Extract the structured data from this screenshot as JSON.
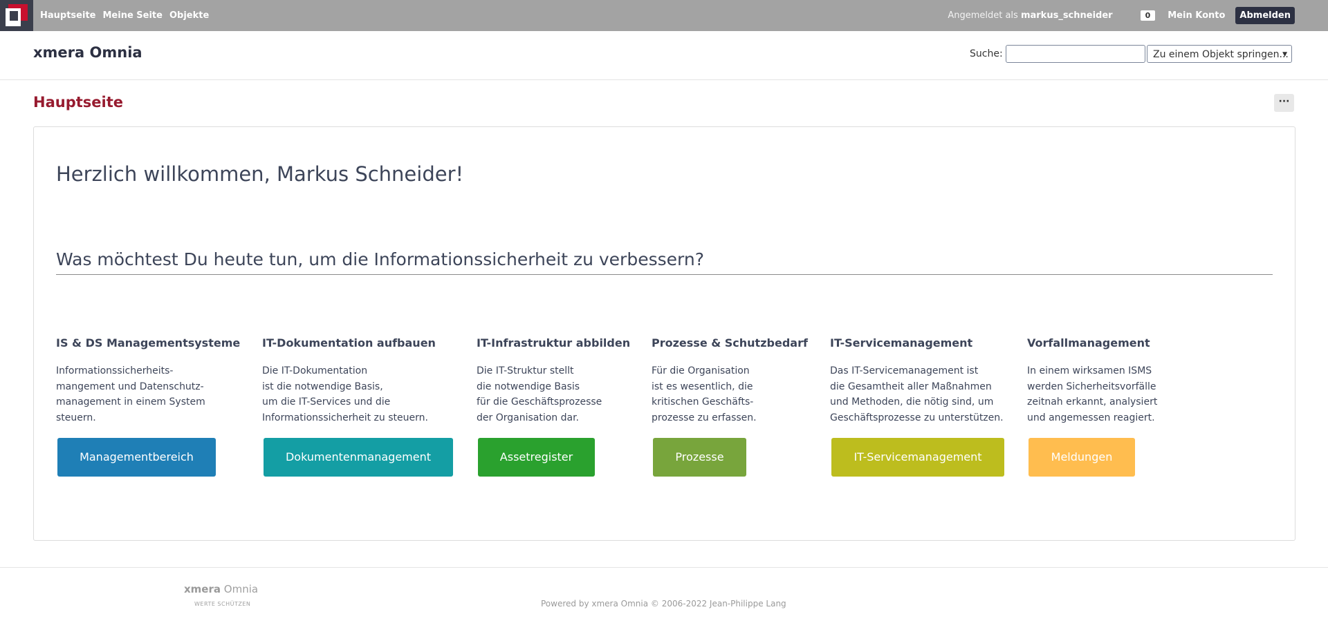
{
  "topbar": {
    "nav": [
      "Hauptseite",
      "Meine Seite",
      "Objekte"
    ],
    "logged_in_prefix": "Angemeldet als",
    "username": "markus_schneider",
    "counter": "0",
    "account": "Mein Konto",
    "logout": "Abmelden"
  },
  "header": {
    "brand": "xmera Omnia",
    "search_label": "Suche:",
    "search_value": "",
    "jump_select": "Zu einem Objekt springen..."
  },
  "page": {
    "title": "Hauptseite",
    "more_label": "···"
  },
  "welcome": "Herzlich willkommen, Markus Schneider!",
  "question": "Was möchtest Du heute tun, um die Informationssicherheit zu verbessern?",
  "sections": [
    {
      "title": "IS & DS Managementsysteme",
      "text": "Informationssicherheits-\nmangement und Datenschutz-\nmanagement in einem System\nsteuern.",
      "button": "Managementbereich",
      "color": "#1f7fb6"
    },
    {
      "title": "IT-Dokumentation aufbauen",
      "text": "Die IT-Dokumentation\nist die notwendige Basis,\num die IT-Services und die\nInformationssicherheit zu steuern.",
      "button": "Dokumentenmanagement",
      "color": "#149ea4"
    },
    {
      "title": "IT-Infrastruktur abbilden",
      "text": "Die IT-Struktur stellt\ndie notwendige Basis\nfür die Geschäftsprozesse\nder Organisation dar.",
      "button": "Assetregister",
      "color": "#2aa12e"
    },
    {
      "title": "Prozesse & Schutzbedarf",
      "text": "Für die Organisation\nist es wesentlich, die\nkritischen Geschäfts-\nprozesse zu erfassen.",
      "button": "Prozesse",
      "color": "#78a53c"
    },
    {
      "title": "IT-Servicemanagement",
      "text": "Das IT-Servicemanagement ist\ndie Gesamtheit aller Maßnahmen\nund Methoden, die nötig sind, um\nGeschäftsprozesse zu unterstützen.",
      "button": "IT-Servicemanagement",
      "color": "#bdbd1e"
    },
    {
      "title": "Vorfallmanagement",
      "text": "In einem wirksamen ISMS\nwerden Sicherheitsvorfälle\nzeitnah erkannt, analysiert\nund angemessen reagiert.",
      "button": "Meldungen",
      "color": "#ffbd4f"
    }
  ],
  "footer": {
    "brand_bold": "xmera",
    "brand_rest": "Omnia",
    "tagline": "WERTE SCHÜTZEN",
    "powered": "Powered by xmera Omnia © 2006-2022 Jean-Philippe Lang"
  }
}
